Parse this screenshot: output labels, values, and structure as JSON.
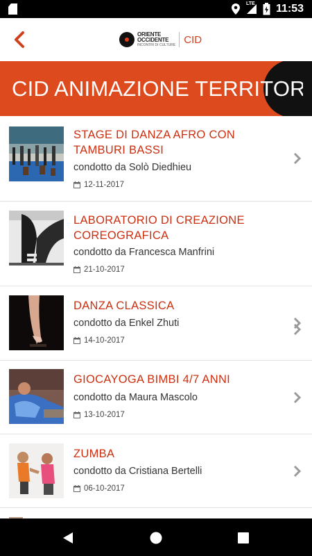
{
  "status_bar": {
    "network": "LTE",
    "time": "11:53"
  },
  "header": {
    "logo_line1": "ORIENTE",
    "logo_line2": "OCCIDENTE",
    "logo_line3": "INCONTRI DI CULTURE",
    "section": "CID"
  },
  "banner": {
    "title": "CID ANIMAZIONE TERRITORI..."
  },
  "items": [
    {
      "title": "STAGE DI DANZA AFRO CON TAMBURI BASSI",
      "by": "condotto da Solò Diedhieu",
      "date": "12-11-2017"
    },
    {
      "title": "LABORATORIO DI CREAZIONE COREOGRAFICA",
      "by": "condotto da Francesca Manfrini",
      "date": "21-10-2017"
    },
    {
      "title": "DANZA CLASSICA",
      "by": "condotto da Enkel Zhuti",
      "date": "14-10-2017"
    },
    {
      "title": "GIOCAYOGA BIMBI 4/7 ANNI",
      "by": "condotto da Maura Mascolo",
      "date": "13-10-2017"
    },
    {
      "title": "ZUMBA",
      "by": "condotto da Cristiana Bertelli",
      "date": "06-10-2017"
    }
  ],
  "colors": {
    "accent": "#dd4a1d",
    "title_red": "#cc2f10"
  }
}
